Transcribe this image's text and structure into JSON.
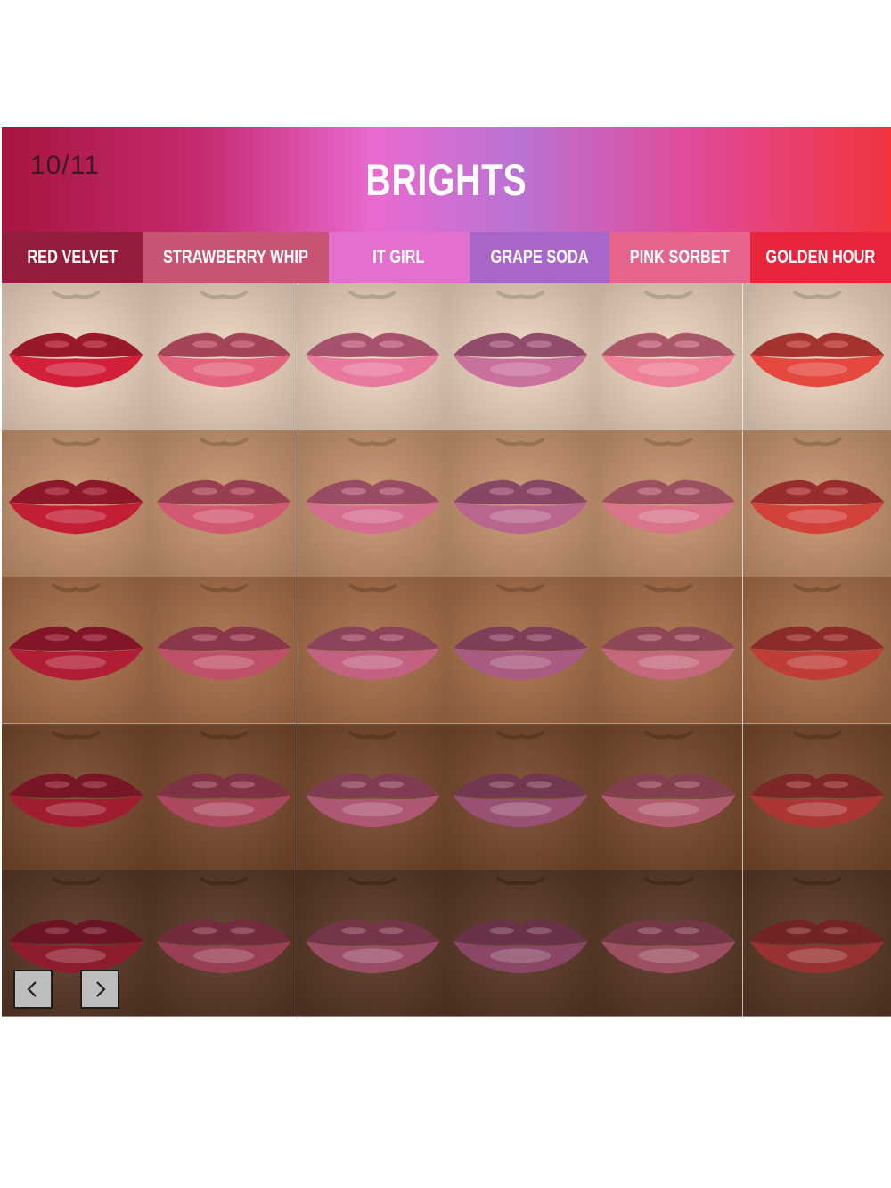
{
  "gallery": {
    "counter": "10/11",
    "title": "BRIGHTS",
    "shades": [
      {
        "name": "RED VELVET",
        "color": "#951c3c",
        "lip": "#d3203a"
      },
      {
        "name": "STRAWBERRY WHIP",
        "color": "#c85474",
        "lip": "#e4637c"
      },
      {
        "name": "IT GIRL",
        "color": "#e36fcf",
        "lip": "#e9799c"
      },
      {
        "name": "GRAPE SODA",
        "color": "#a866c8",
        "lip": "#c9709d"
      },
      {
        "name": "PINK SORBET",
        "color": "#e6648c",
        "lip": "#ed8096"
      },
      {
        "name": "GOLDEN HOUR",
        "color": "#e8253c",
        "lip": "#e5483e"
      }
    ],
    "skin_tones": [
      "#f0d7c2",
      "#c99670",
      "#a87049",
      "#7a4a2d",
      "#5a3826"
    ],
    "nav": {
      "prev_icon": "chevron-left-icon",
      "next_icon": "chevron-right-icon"
    }
  }
}
